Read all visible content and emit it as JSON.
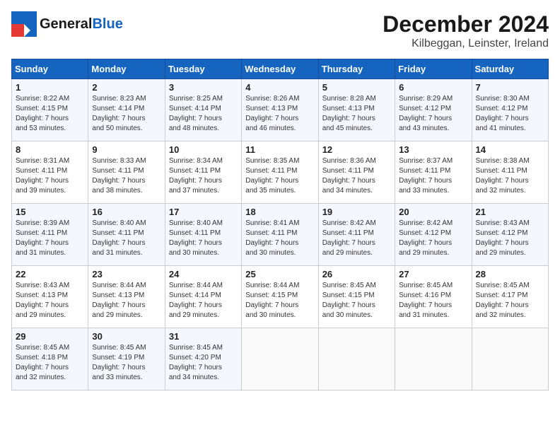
{
  "header": {
    "logo_line1": "General",
    "logo_line2": "Blue",
    "month": "December 2024",
    "location": "Kilbeggan, Leinster, Ireland"
  },
  "weekdays": [
    "Sunday",
    "Monday",
    "Tuesday",
    "Wednesday",
    "Thursday",
    "Friday",
    "Saturday"
  ],
  "weeks": [
    [
      {
        "day": "1",
        "sunrise": "Sunrise: 8:22 AM",
        "sunset": "Sunset: 4:15 PM",
        "daylight": "Daylight: 7 hours and 53 minutes."
      },
      {
        "day": "2",
        "sunrise": "Sunrise: 8:23 AM",
        "sunset": "Sunset: 4:14 PM",
        "daylight": "Daylight: 7 hours and 50 minutes."
      },
      {
        "day": "3",
        "sunrise": "Sunrise: 8:25 AM",
        "sunset": "Sunset: 4:14 PM",
        "daylight": "Daylight: 7 hours and 48 minutes."
      },
      {
        "day": "4",
        "sunrise": "Sunrise: 8:26 AM",
        "sunset": "Sunset: 4:13 PM",
        "daylight": "Daylight: 7 hours and 46 minutes."
      },
      {
        "day": "5",
        "sunrise": "Sunrise: 8:28 AM",
        "sunset": "Sunset: 4:13 PM",
        "daylight": "Daylight: 7 hours and 45 minutes."
      },
      {
        "day": "6",
        "sunrise": "Sunrise: 8:29 AM",
        "sunset": "Sunset: 4:12 PM",
        "daylight": "Daylight: 7 hours and 43 minutes."
      },
      {
        "day": "7",
        "sunrise": "Sunrise: 8:30 AM",
        "sunset": "Sunset: 4:12 PM",
        "daylight": "Daylight: 7 hours and 41 minutes."
      }
    ],
    [
      {
        "day": "8",
        "sunrise": "Sunrise: 8:31 AM",
        "sunset": "Sunset: 4:11 PM",
        "daylight": "Daylight: 7 hours and 39 minutes."
      },
      {
        "day": "9",
        "sunrise": "Sunrise: 8:33 AM",
        "sunset": "Sunset: 4:11 PM",
        "daylight": "Daylight: 7 hours and 38 minutes."
      },
      {
        "day": "10",
        "sunrise": "Sunrise: 8:34 AM",
        "sunset": "Sunset: 4:11 PM",
        "daylight": "Daylight: 7 hours and 37 minutes."
      },
      {
        "day": "11",
        "sunrise": "Sunrise: 8:35 AM",
        "sunset": "Sunset: 4:11 PM",
        "daylight": "Daylight: 7 hours and 35 minutes."
      },
      {
        "day": "12",
        "sunrise": "Sunrise: 8:36 AM",
        "sunset": "Sunset: 4:11 PM",
        "daylight": "Daylight: 7 hours and 34 minutes."
      },
      {
        "day": "13",
        "sunrise": "Sunrise: 8:37 AM",
        "sunset": "Sunset: 4:11 PM",
        "daylight": "Daylight: 7 hours and 33 minutes."
      },
      {
        "day": "14",
        "sunrise": "Sunrise: 8:38 AM",
        "sunset": "Sunset: 4:11 PM",
        "daylight": "Daylight: 7 hours and 32 minutes."
      }
    ],
    [
      {
        "day": "15",
        "sunrise": "Sunrise: 8:39 AM",
        "sunset": "Sunset: 4:11 PM",
        "daylight": "Daylight: 7 hours and 31 minutes."
      },
      {
        "day": "16",
        "sunrise": "Sunrise: 8:40 AM",
        "sunset": "Sunset: 4:11 PM",
        "daylight": "Daylight: 7 hours and 31 minutes."
      },
      {
        "day": "17",
        "sunrise": "Sunrise: 8:40 AM",
        "sunset": "Sunset: 4:11 PM",
        "daylight": "Daylight: 7 hours and 30 minutes."
      },
      {
        "day": "18",
        "sunrise": "Sunrise: 8:41 AM",
        "sunset": "Sunset: 4:11 PM",
        "daylight": "Daylight: 7 hours and 30 minutes."
      },
      {
        "day": "19",
        "sunrise": "Sunrise: 8:42 AM",
        "sunset": "Sunset: 4:11 PM",
        "daylight": "Daylight: 7 hours and 29 minutes."
      },
      {
        "day": "20",
        "sunrise": "Sunrise: 8:42 AM",
        "sunset": "Sunset: 4:12 PM",
        "daylight": "Daylight: 7 hours and 29 minutes."
      },
      {
        "day": "21",
        "sunrise": "Sunrise: 8:43 AM",
        "sunset": "Sunset: 4:12 PM",
        "daylight": "Daylight: 7 hours and 29 minutes."
      }
    ],
    [
      {
        "day": "22",
        "sunrise": "Sunrise: 8:43 AM",
        "sunset": "Sunset: 4:13 PM",
        "daylight": "Daylight: 7 hours and 29 minutes."
      },
      {
        "day": "23",
        "sunrise": "Sunrise: 8:44 AM",
        "sunset": "Sunset: 4:13 PM",
        "daylight": "Daylight: 7 hours and 29 minutes."
      },
      {
        "day": "24",
        "sunrise": "Sunrise: 8:44 AM",
        "sunset": "Sunset: 4:14 PM",
        "daylight": "Daylight: 7 hours and 29 minutes."
      },
      {
        "day": "25",
        "sunrise": "Sunrise: 8:44 AM",
        "sunset": "Sunset: 4:15 PM",
        "daylight": "Daylight: 7 hours and 30 minutes."
      },
      {
        "day": "26",
        "sunrise": "Sunrise: 8:45 AM",
        "sunset": "Sunset: 4:15 PM",
        "daylight": "Daylight: 7 hours and 30 minutes."
      },
      {
        "day": "27",
        "sunrise": "Sunrise: 8:45 AM",
        "sunset": "Sunset: 4:16 PM",
        "daylight": "Daylight: 7 hours and 31 minutes."
      },
      {
        "day": "28",
        "sunrise": "Sunrise: 8:45 AM",
        "sunset": "Sunset: 4:17 PM",
        "daylight": "Daylight: 7 hours and 32 minutes."
      }
    ],
    [
      {
        "day": "29",
        "sunrise": "Sunrise: 8:45 AM",
        "sunset": "Sunset: 4:18 PM",
        "daylight": "Daylight: 7 hours and 32 minutes."
      },
      {
        "day": "30",
        "sunrise": "Sunrise: 8:45 AM",
        "sunset": "Sunset: 4:19 PM",
        "daylight": "Daylight: 7 hours and 33 minutes."
      },
      {
        "day": "31",
        "sunrise": "Sunrise: 8:45 AM",
        "sunset": "Sunset: 4:20 PM",
        "daylight": "Daylight: 7 hours and 34 minutes."
      },
      null,
      null,
      null,
      null
    ]
  ]
}
